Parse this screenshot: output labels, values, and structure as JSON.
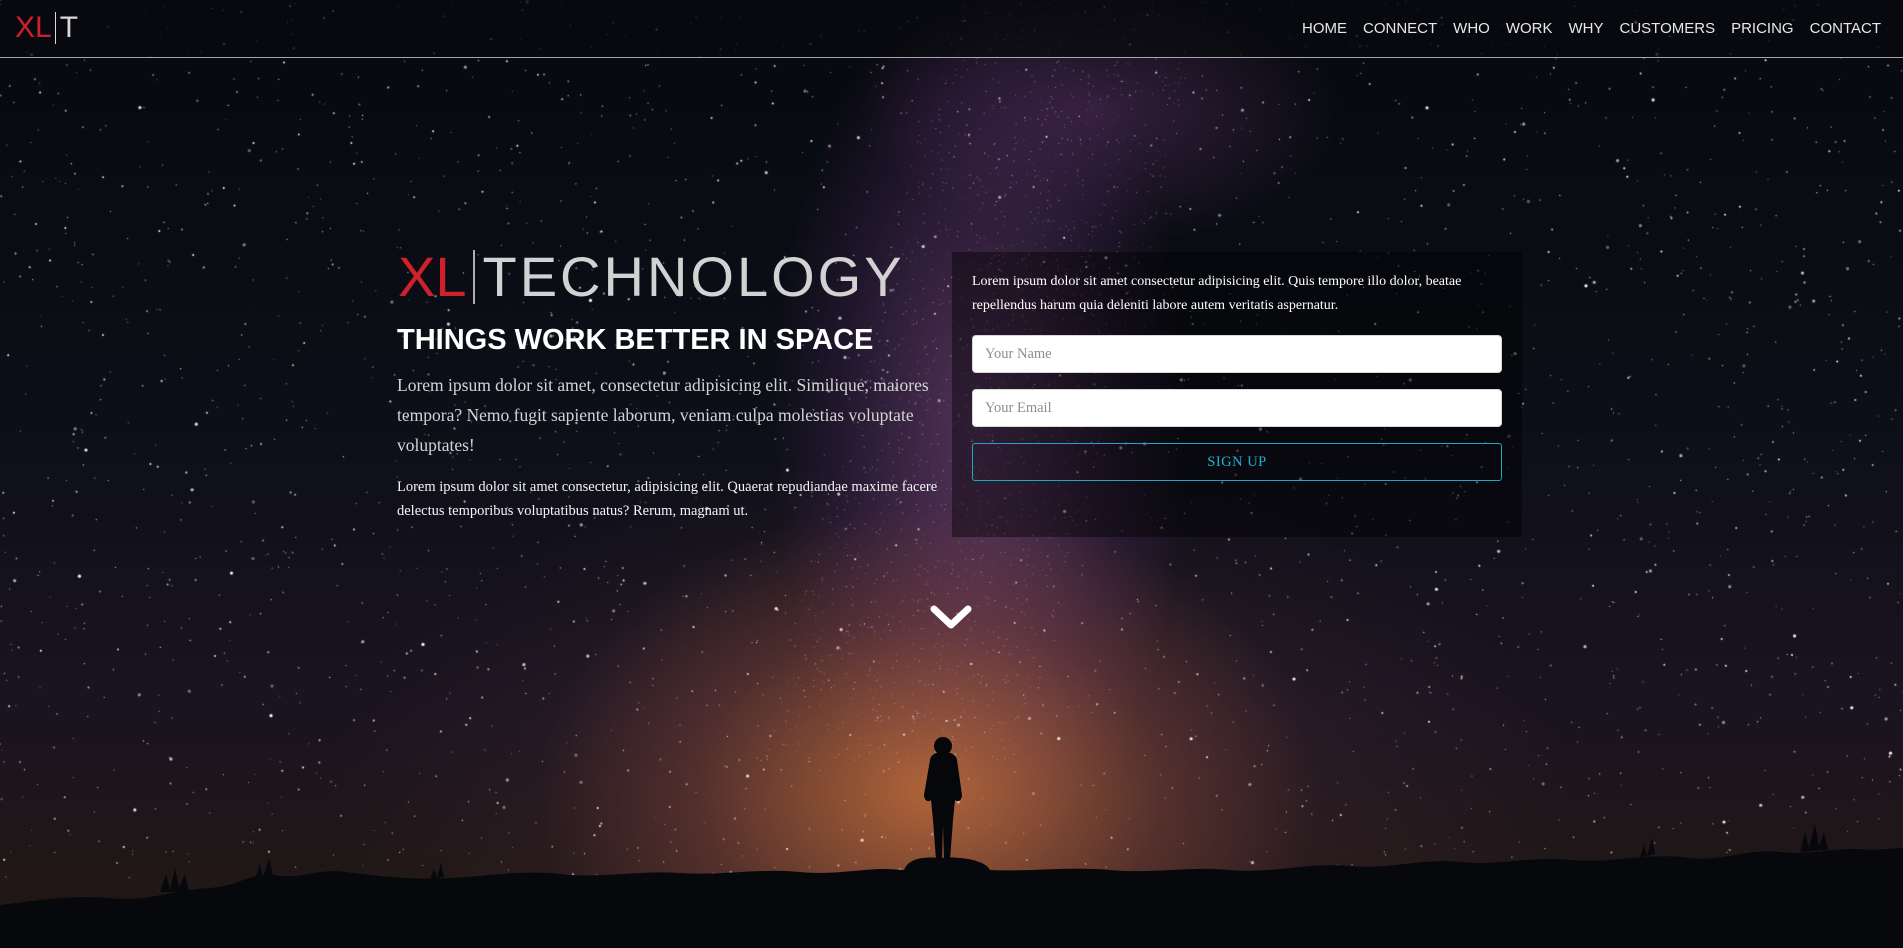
{
  "nav": {
    "logo": {
      "xl": "XL",
      "t": "T"
    },
    "links": [
      "HOME",
      "CONNECT",
      "WHO",
      "WORK",
      "WHY",
      "CUSTOMERS",
      "PRICING",
      "CONTACT"
    ]
  },
  "hero": {
    "brand_xl": "XL",
    "brand_word": "TECHNOLOGY",
    "tagline": "THINGS WORK BETTER IN SPACE",
    "lead": "Lorem ipsum dolor sit amet, consectetur adipisicing elit. Similique, maiores tempora? Nemo fugit sapiente laborum, veniam culpa molestias voluptate voluptates!",
    "small": "Lorem ipsum dolor sit amet consectetur, adipisicing elit. Quaerat repudiandae maxime facere delectus temporibus voluptatibus natus? Rerum, magnam ut."
  },
  "signup_form": {
    "intro": "Lorem ipsum dolor sit amet consectetur adipisicing elit. Quis tempore illo dolor, beatae repellendus harum quia deleniti labore autem veritatis aspernatur.",
    "name_placeholder": "Your Name",
    "email_placeholder": "Your Email",
    "submit_label": "SIGN UP"
  },
  "colors": {
    "brand_red": "#d0202c",
    "accent_cyan": "#1fa7c4",
    "nav_text": "#e8e8e8"
  },
  "icons": {
    "scroll": "chevron-down-icon"
  }
}
